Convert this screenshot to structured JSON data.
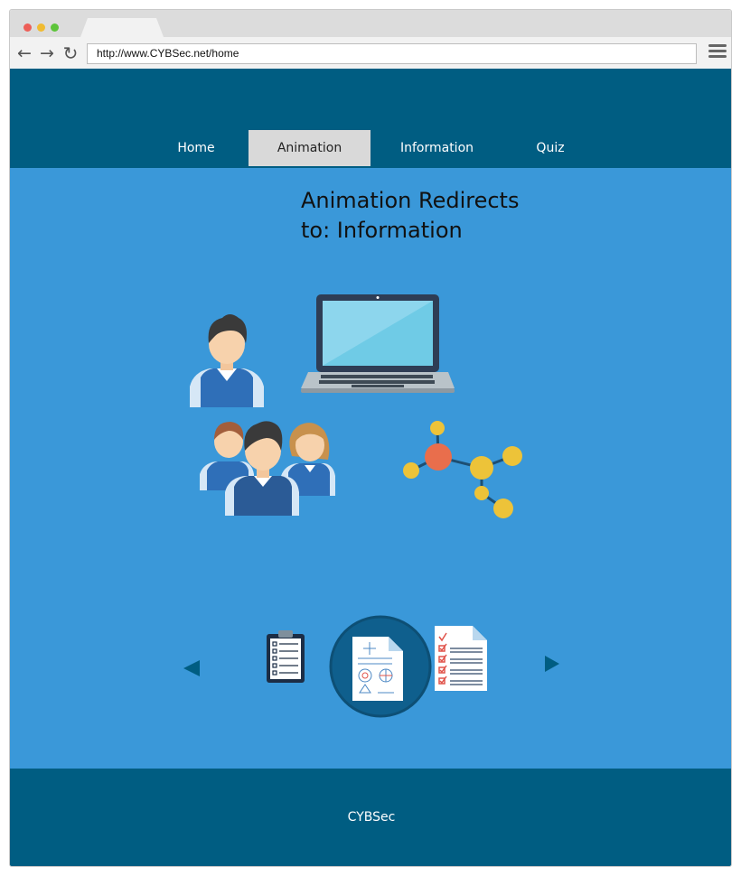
{
  "browser": {
    "url": "http://www.CYBSec.net/home",
    "icons": {
      "back": "arrow-left-icon",
      "forward": "arrow-right-icon",
      "reload": "reload-icon",
      "menu": "hamburger-menu-icon"
    }
  },
  "nav": {
    "items": [
      {
        "label": "Home"
      },
      {
        "label": "Animation",
        "active": true
      },
      {
        "label": "Information"
      },
      {
        "label": "Quiz"
      }
    ]
  },
  "main": {
    "heading": "Animation Redirects to: Information",
    "illustrations": [
      "student-icon",
      "laptop-icon",
      "student-group-icon",
      "molecule-icon"
    ],
    "carousel": {
      "items": [
        "clipboard-checklist-icon",
        "math-document-icon",
        "checklist-document-icon"
      ],
      "active_item": "math-document-icon"
    }
  },
  "footer": {
    "text": "CYBSec"
  },
  "colors": {
    "header": "#005d82",
    "main_bg": "#3a98d9",
    "nav_active_bg": "#d9d9d9",
    "footer": "#005d82"
  }
}
